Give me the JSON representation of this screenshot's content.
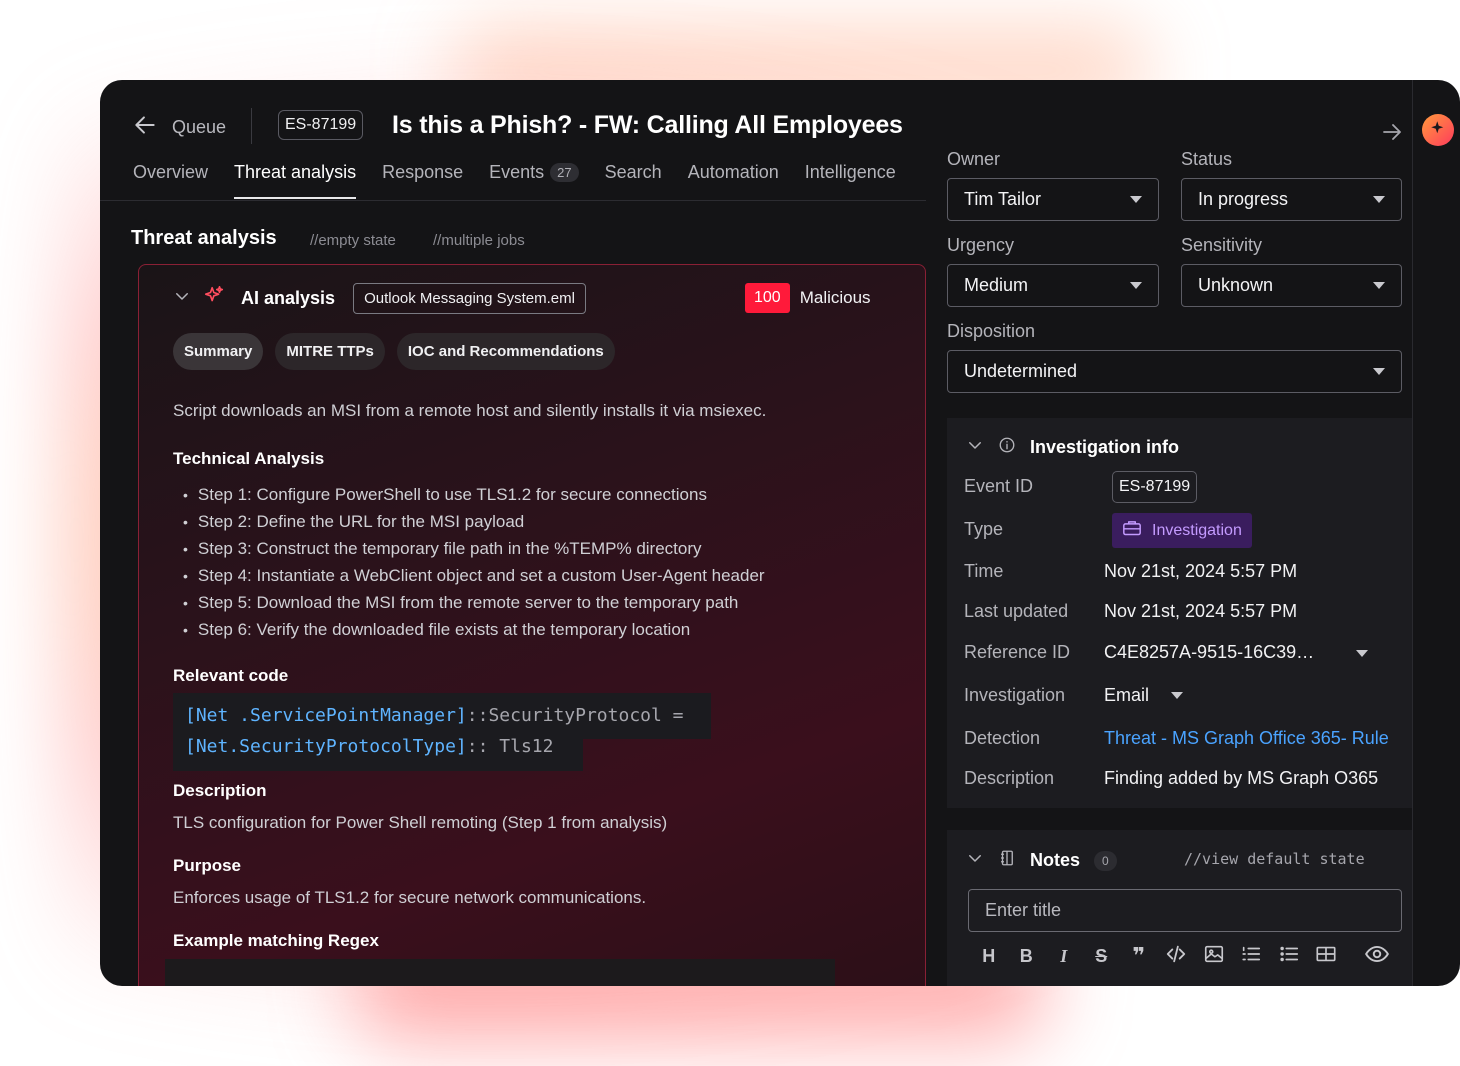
{
  "header": {
    "back_label": "Queue",
    "event_id": "ES-87199",
    "title": "Is this a Phish? - FW: Calling All Employees"
  },
  "tabs": [
    {
      "label": "Overview"
    },
    {
      "label": "Threat analysis",
      "active": true
    },
    {
      "label": "Response"
    },
    {
      "label": "Events",
      "badge": "27"
    },
    {
      "label": "Search"
    },
    {
      "label": "Automation"
    },
    {
      "label": "Intelligence"
    }
  ],
  "threat_analysis": {
    "title": "Threat analysis",
    "note_empty": "//empty state",
    "note_multiple": "//multiple jobs",
    "ai": {
      "title": "AI analysis",
      "file": "Outlook Messaging System.eml",
      "score": "100",
      "verdict": "Malicious",
      "pills": [
        "Summary",
        "MITRE TTPs",
        "IOC and Recommendations"
      ],
      "summary": "Script downloads an MSI from a remote host and silently installs it via msiexec.",
      "technical_heading": "Technical Analysis",
      "steps": [
        "Step 1: Configure PowerShell to use TLS1.2 for secure connections",
        "Step 2: Define the URL for the MSI payload",
        "Step 3: Construct the temporary file path in the %TEMP% directory",
        "Step 4: Instantiate a WebClient object and set a custom User-Agent header",
        "Step 5: Download the MSI from the remote server to the temporary path",
        "Step 6: Verify the downloaded file exists at the temporary location"
      ],
      "code_heading": "Relevant code",
      "code": {
        "l1a": "[Net .ServicePointManager]",
        "l1b": "::SecurityProtocol =",
        "l2a": "[Net.SecurityProtocolType]",
        "l2b": ":: Tls12"
      },
      "description_heading": "Description",
      "description": "TLS configuration for Power Shell remoting (Step 1 from analysis)",
      "purpose_heading": "Purpose",
      "purpose": "Enforces usage of TLS1.2 for secure network communications.",
      "regex_heading": "Example matching Regex"
    }
  },
  "fields": {
    "owner": {
      "label": "Owner",
      "value": "Tim Tailor"
    },
    "status": {
      "label": "Status",
      "value": "In progress"
    },
    "urgency": {
      "label": "Urgency",
      "value": "Medium"
    },
    "sensitivity": {
      "label": "Sensitivity",
      "value": "Unknown"
    },
    "disposition": {
      "label": "Disposition",
      "value": "Undetermined"
    }
  },
  "investigation_info": {
    "title": "Investigation info",
    "rows": {
      "event_id": {
        "label": "Event ID",
        "value": "ES-87199"
      },
      "type": {
        "label": "Type",
        "value": "Investigation"
      },
      "time": {
        "label": "Time",
        "value": "Nov 21st, 2024 5:57 PM"
      },
      "last_updated": {
        "label": "Last updated",
        "value": "Nov 21st, 2024 5:57 PM"
      },
      "reference_id": {
        "label": "Reference ID",
        "value": "C4E8257A-9515-16C39…"
      },
      "investigation": {
        "label": "Investigation",
        "value": "Email"
      },
      "detection": {
        "label": "Detection",
        "value": "Threat - MS Graph Office 365- Rule"
      },
      "description": {
        "label": "Description",
        "value": "Finding added by MS Graph O365"
      }
    }
  },
  "notes": {
    "title": "Notes",
    "count": "0",
    "note": "//view default state",
    "title_placeholder": "Enter title",
    "toolbar": {
      "heading": "H",
      "bold": "B",
      "italic": "I",
      "strike": "S",
      "quote": "❞"
    }
  },
  "colors": {
    "accent_red": "#ff1a3a",
    "link_blue": "#4aa3ff",
    "type_purple": "#c49bff"
  }
}
